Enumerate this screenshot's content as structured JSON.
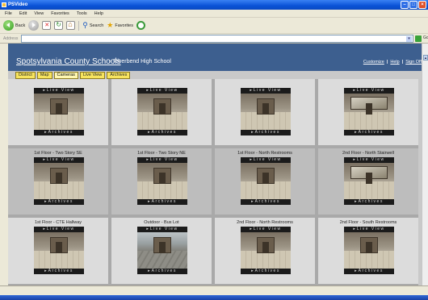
{
  "window": {
    "title": "PSVideo",
    "minimize_glyph": "–",
    "maximize_glyph": "□",
    "close_glyph": "×"
  },
  "menu": [
    "File",
    "Edit",
    "View",
    "Favorites",
    "Tools",
    "Help"
  ],
  "toolbar": {
    "back_label": "Back",
    "search_label": "Search",
    "favorites_label": "Favorites"
  },
  "address": {
    "label": "Address",
    "go_label": "Go",
    "dropdown_glyph": "▾"
  },
  "page": {
    "school_name": "Spotsylvania County Schools",
    "school_sub": "- Riverbend High School",
    "links": [
      "Customize",
      "Help",
      "Sign Off"
    ],
    "link_separator": "|"
  },
  "nav_tabs": [
    {
      "label": "District",
      "active": false
    },
    {
      "label": "Map",
      "active": false
    },
    {
      "label": "Cameras",
      "active": true
    },
    {
      "label": "Live View",
      "active": false
    },
    {
      "label": "Archives",
      "active": false
    }
  ],
  "camera_controls": {
    "live_label": "Live View",
    "archives_label": "Archives"
  },
  "cameras": [
    {
      "title": "",
      "scene": "hall"
    },
    {
      "title": "",
      "scene": "hall"
    },
    {
      "title": "",
      "scene": "doors"
    },
    {
      "title": "",
      "scene": "stair"
    },
    {
      "title": "1st Floor - Two Story SE",
      "scene": "hall"
    },
    {
      "title": "1st Floor - Two Story NE",
      "scene": "hall"
    },
    {
      "title": "1st Floor - North Restrooms",
      "scene": "doors"
    },
    {
      "title": "2nd Floor - North Stairwell",
      "scene": "stair"
    },
    {
      "title": "1st Floor - CTE Hallway",
      "scene": "hall"
    },
    {
      "title": "Outdoor - Bus Lot",
      "scene": "outdoor"
    },
    {
      "title": "2nd Floor - North Restrooms",
      "scene": "doors"
    },
    {
      "title": "2nd Floor - South Restrooms",
      "scene": "doors"
    }
  ],
  "scrollbar": {
    "up_glyph": "▲"
  },
  "colors": {
    "header_blue": "#3d5f8f",
    "tab_yellow": "#f7e45e",
    "xp_titlebar": "#0a52d6"
  }
}
